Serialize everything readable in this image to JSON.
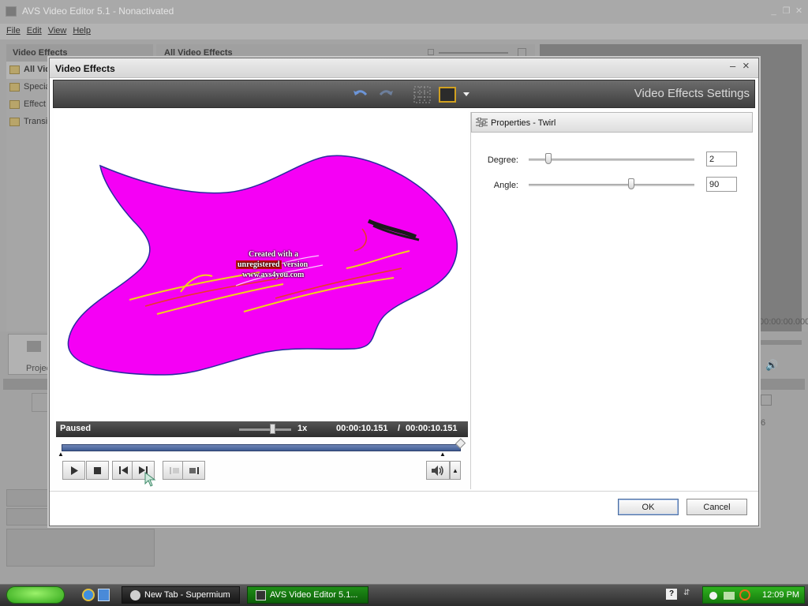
{
  "app": {
    "title": "AVS Video Editor 5.1 - Nonactivated",
    "menu": [
      "File",
      "Edit",
      "View",
      "Help"
    ],
    "left_panel_title": "Video Effects",
    "left_items": [
      "All Vid",
      "Specia",
      "Effect",
      "Transi"
    ],
    "mid_panel_title": "All Video Effects",
    "timeline_time": "00:00:00.000",
    "projects_label": "Projec",
    "ruler_mark": "6"
  },
  "dialog": {
    "title": "Video Effects",
    "toolbar_title": "Video Effects Settings",
    "watermark": {
      "line1": "Created with a",
      "line2_highlight": "unregistered",
      "line2_rest": "version",
      "line3": "www.avs4you.com"
    },
    "status": {
      "state": "Paused",
      "speed": "1x",
      "current_time": "00:00:10.151",
      "separator": "/",
      "total_time": "00:00:10.151",
      "speed_level": 0.65,
      "seek_fraction": 1.0
    },
    "properties": {
      "title": "Properties - Twirl",
      "params": [
        {
          "label": "Degree:",
          "value": "2",
          "slider_fraction": 0.12
        },
        {
          "label": "Angle:",
          "value": "90",
          "slider_fraction": 0.62
        }
      ]
    },
    "buttons": {
      "ok": "OK",
      "cancel": "Cancel"
    }
  },
  "taskbar": {
    "tasks": [
      "New Tab - Supermium",
      "AVS Video Editor 5.1..."
    ],
    "clock": "12:09 PM"
  },
  "colors": {
    "effect_fill": "#f500f5",
    "seek_fill": "#4a66a0",
    "toolbar_bg": "#4a4a4a",
    "taskbar_green": "#1f8e17"
  }
}
